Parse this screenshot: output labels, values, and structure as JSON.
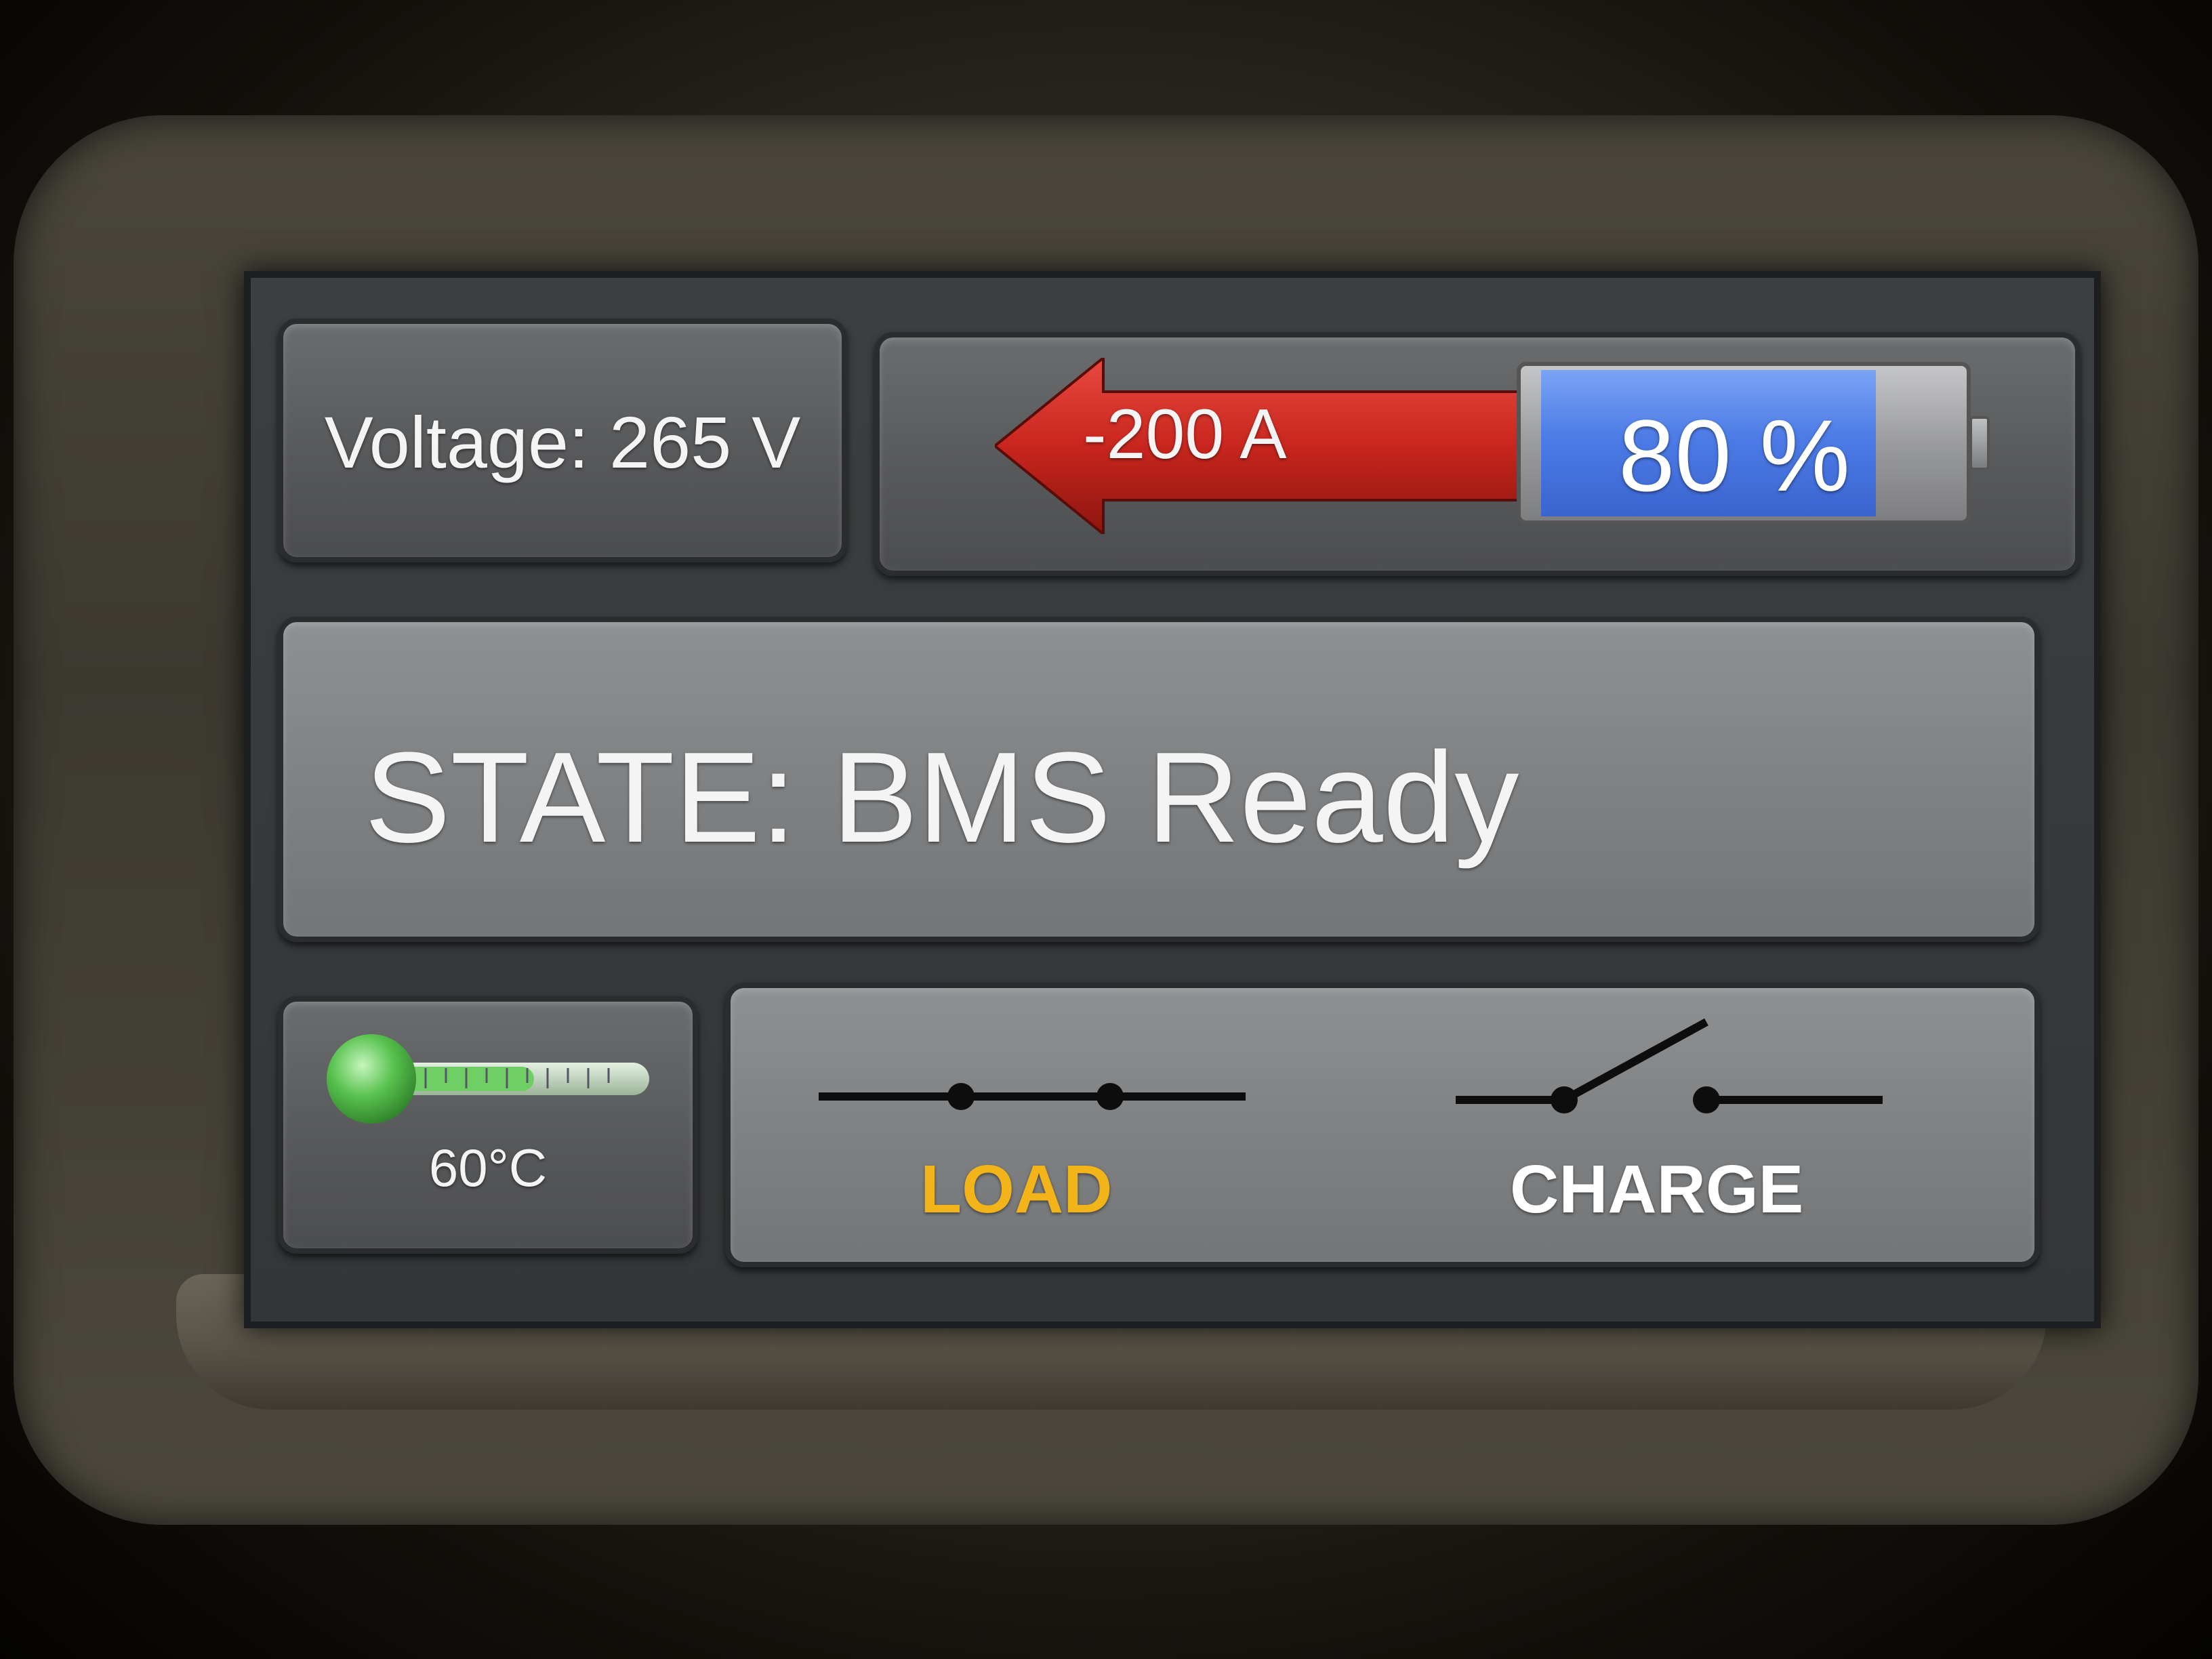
{
  "voltage": {
    "label": "Voltage: 265 V"
  },
  "current": {
    "label": "-200 A",
    "direction": "discharge",
    "arrow_color": "#c8261e"
  },
  "battery": {
    "label": "80 %",
    "level": 0.8,
    "fill_color": "#4d7ce6"
  },
  "state": {
    "label": "STATE: BMS Ready"
  },
  "temperature": {
    "label": "60°C",
    "icon": "thermometer-icon",
    "indicator_color": "#58c24e"
  },
  "switches": {
    "load": {
      "label": "LOAD",
      "status": "closed",
      "label_color": "#f3b41a"
    },
    "charge": {
      "label": "CHARGE",
      "status": "open",
      "label_color": "#ffffff"
    }
  }
}
